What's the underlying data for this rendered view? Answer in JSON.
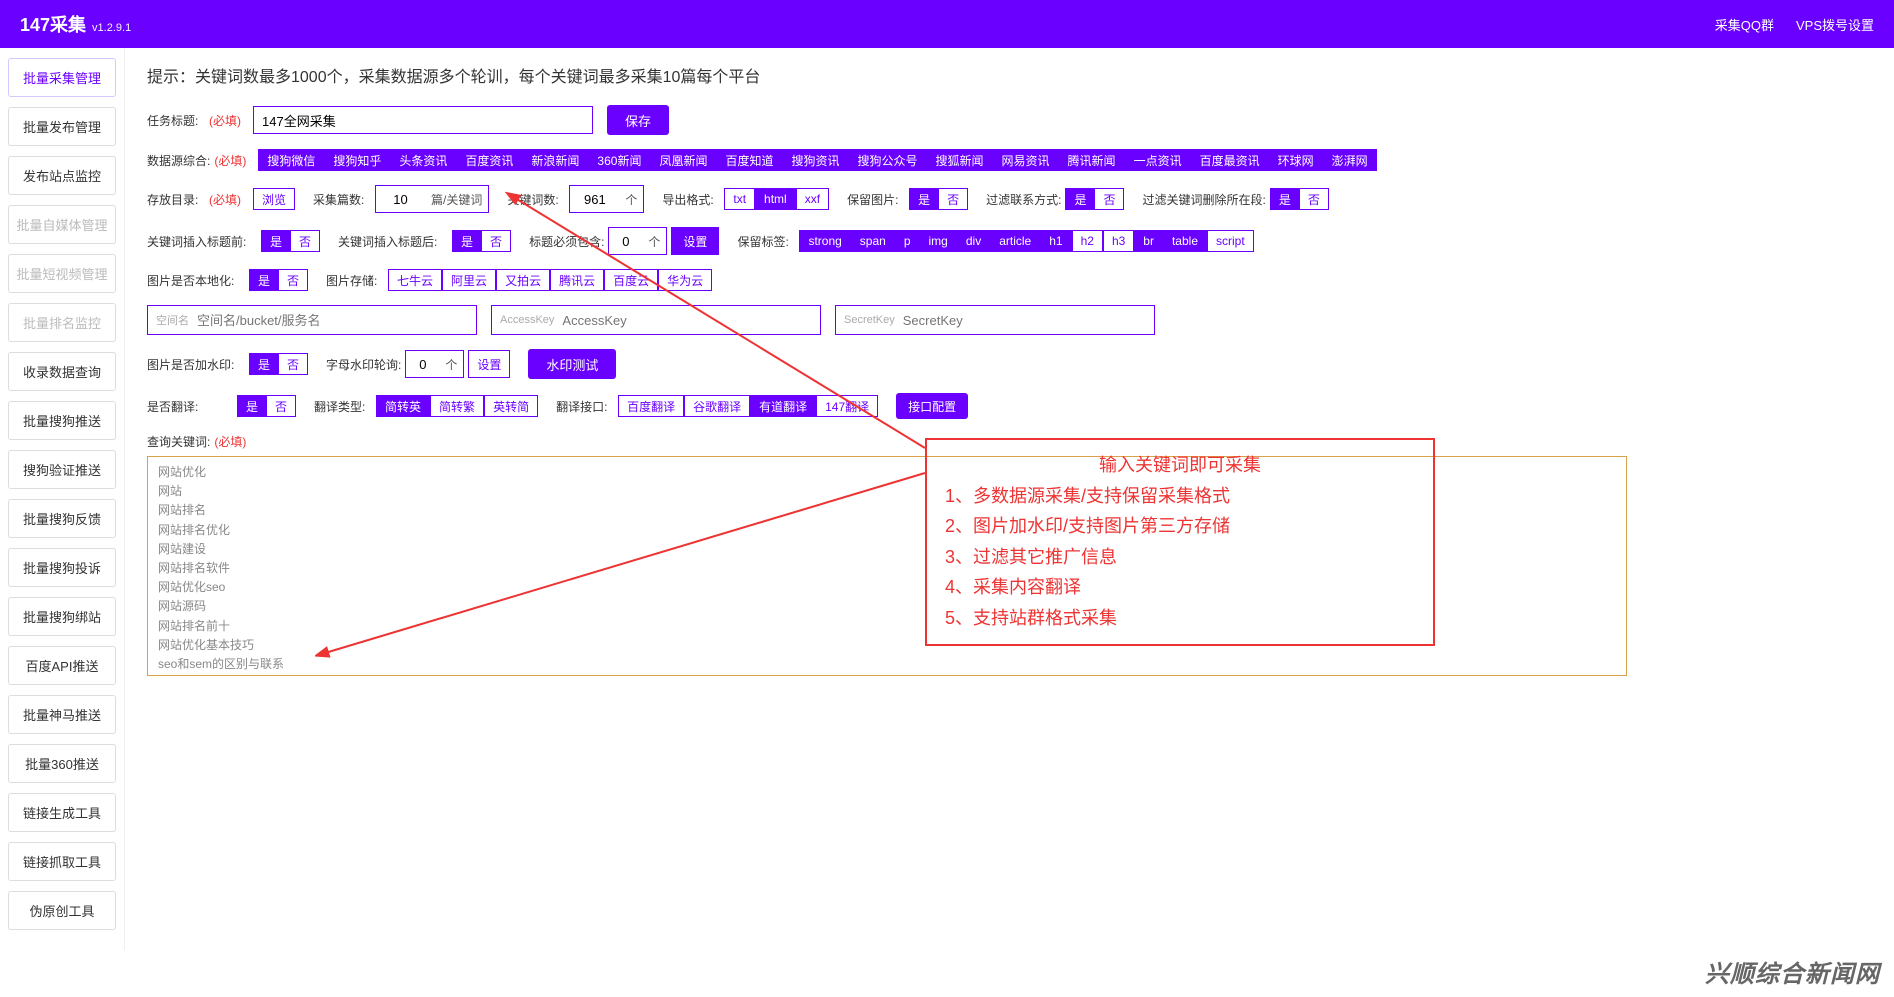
{
  "header": {
    "brand": "147采集",
    "version": "v1.2.9.1",
    "links": [
      "采集QQ群",
      "VPS拨号设置"
    ]
  },
  "sidebar": [
    {
      "label": "批量采集管理",
      "state": "active"
    },
    {
      "label": "批量发布管理",
      "state": ""
    },
    {
      "label": "发布站点监控",
      "state": ""
    },
    {
      "label": "批量自媒体管理",
      "state": "disabled"
    },
    {
      "label": "批量短视频管理",
      "state": "disabled"
    },
    {
      "label": "批量排名监控",
      "state": "disabled"
    },
    {
      "label": "收录数据查询",
      "state": ""
    },
    {
      "label": "批量搜狗推送",
      "state": ""
    },
    {
      "label": "搜狗验证推送",
      "state": ""
    },
    {
      "label": "批量搜狗反馈",
      "state": ""
    },
    {
      "label": "批量搜狗投诉",
      "state": ""
    },
    {
      "label": "批量搜狗绑站",
      "state": ""
    },
    {
      "label": "百度API推送",
      "state": ""
    },
    {
      "label": "批量神马推送",
      "state": ""
    },
    {
      "label": "批量360推送",
      "state": ""
    },
    {
      "label": "链接生成工具",
      "state": ""
    },
    {
      "label": "链接抓取工具",
      "state": ""
    },
    {
      "label": "伪原创工具",
      "state": ""
    }
  ],
  "hint": "提示：关键词数最多1000个，采集数据源多个轮训，每个关键词最多采集10篇每个平台",
  "task": {
    "title_label": "任务标题:",
    "required": "(必填)",
    "title_value": "147全网采集",
    "save": "保存"
  },
  "sources": {
    "label": "数据源综合:",
    "items": [
      {
        "name": "搜狗微信",
        "on": true
      },
      {
        "name": "搜狗知乎",
        "on": true
      },
      {
        "name": "头条资讯",
        "on": true
      },
      {
        "name": "百度资讯",
        "on": true
      },
      {
        "name": "新浪新闻",
        "on": true
      },
      {
        "name": "360新闻",
        "on": true
      },
      {
        "name": "凤凰新闻",
        "on": true
      },
      {
        "name": "百度知道",
        "on": true
      },
      {
        "name": "搜狗资讯",
        "on": true
      },
      {
        "name": "搜狗公众号",
        "on": true
      },
      {
        "name": "搜狐新闻",
        "on": true
      },
      {
        "name": "网易资讯",
        "on": true
      },
      {
        "name": "腾讯新闻",
        "on": true
      },
      {
        "name": "一点资讯",
        "on": true
      },
      {
        "name": "百度最资讯",
        "on": true
      },
      {
        "name": "环球网",
        "on": true
      },
      {
        "name": "澎湃网",
        "on": true
      }
    ]
  },
  "store": {
    "label": "存放目录:",
    "browse": "浏览",
    "count_label": "采集篇数:",
    "count_value": "10",
    "count_unit": "篇/关键词",
    "kw_label": "关键词数:",
    "kw_value": "961",
    "kw_unit": "个",
    "export_label": "导出格式:",
    "export_opts": [
      {
        "name": "txt",
        "on": false
      },
      {
        "name": "html",
        "on": true
      },
      {
        "name": "xxf",
        "on": false
      }
    ],
    "keep_img_label": "保留图片:",
    "keep_img_yes": "是",
    "keep_img_no": "否",
    "filter_contact_label": "过滤联系方式:",
    "filter_kw_para_label": "过滤关键词删除所在段:"
  },
  "insert": {
    "before_label": "关键词插入标题前:",
    "after_label": "关键词插入标题后:",
    "title_must_label": "标题必须包含:",
    "title_must_value": "0",
    "title_must_unit": "个",
    "title_must_btn": "设置",
    "keep_tags_label": "保留标签:",
    "keep_tags": [
      {
        "name": "strong",
        "on": true
      },
      {
        "name": "span",
        "on": true
      },
      {
        "name": "p",
        "on": true
      },
      {
        "name": "img",
        "on": true
      },
      {
        "name": "div",
        "on": true
      },
      {
        "name": "article",
        "on": true
      },
      {
        "name": "h1",
        "on": true
      },
      {
        "name": "h2",
        "on": false
      },
      {
        "name": "h3",
        "on": false
      },
      {
        "name": "br",
        "on": true
      },
      {
        "name": "table",
        "on": true
      },
      {
        "name": "script",
        "on": false
      }
    ]
  },
  "image": {
    "local_label": "图片是否本地化:",
    "store_label": "图片存储:",
    "stores": [
      {
        "name": "七牛云",
        "on": false
      },
      {
        "name": "阿里云",
        "on": false
      },
      {
        "name": "又拍云",
        "on": false
      },
      {
        "name": "腾讯云",
        "on": false
      },
      {
        "name": "百度云",
        "on": false
      },
      {
        "name": "华为云",
        "on": false
      }
    ],
    "space_pre": "空间名",
    "space_ph": "空间名/bucket/服务名",
    "ak_pre": "AccessKey",
    "ak_ph": "AccessKey",
    "sk_pre": "SecretKey",
    "sk_ph": "SecretKey"
  },
  "watermark": {
    "label": "图片是否加水印:",
    "alpha_label": "字母水印轮询:",
    "alpha_value": "0",
    "alpha_unit": "个",
    "alpha_btn": "设置",
    "test": "水印测试"
  },
  "translate": {
    "label": "是否翻译:",
    "type_label": "翻译类型:",
    "types": [
      {
        "name": "简转英",
        "on": true
      },
      {
        "name": "简转繁",
        "on": false
      },
      {
        "name": "英转简",
        "on": false
      }
    ],
    "api_label": "翻译接口:",
    "apis": [
      {
        "name": "百度翻译",
        "on": false
      },
      {
        "name": "谷歌翻译",
        "on": false
      },
      {
        "name": "有道翻译",
        "on": true
      },
      {
        "name": "147翻译",
        "on": false
      }
    ],
    "config": "接口配置"
  },
  "keywords": {
    "label": "查询关键词:",
    "value": "网站优化\n网站\n网站排名\n网站排名优化\n网站建设\n网站排名软件\n网站优化seo\n网站源码\n网站排名前十\n网站优化基本技巧\nseo和sem的区别与联系\n网站搭建\n网站排名查询\n网站优化培训\nseo是什么意思"
  },
  "annotation": {
    "title": "输入关键词即可采集",
    "lines": [
      "1、多数据源采集/支持保留采集格式",
      "2、图片加水印/支持图片第三方存储",
      "3、过滤其它推广信息",
      "4、采集内容翻译",
      "5、支持站群格式采集"
    ]
  },
  "toggles": {
    "yes": "是",
    "no": "否"
  },
  "footer_watermark": "兴顺综合新闻网"
}
